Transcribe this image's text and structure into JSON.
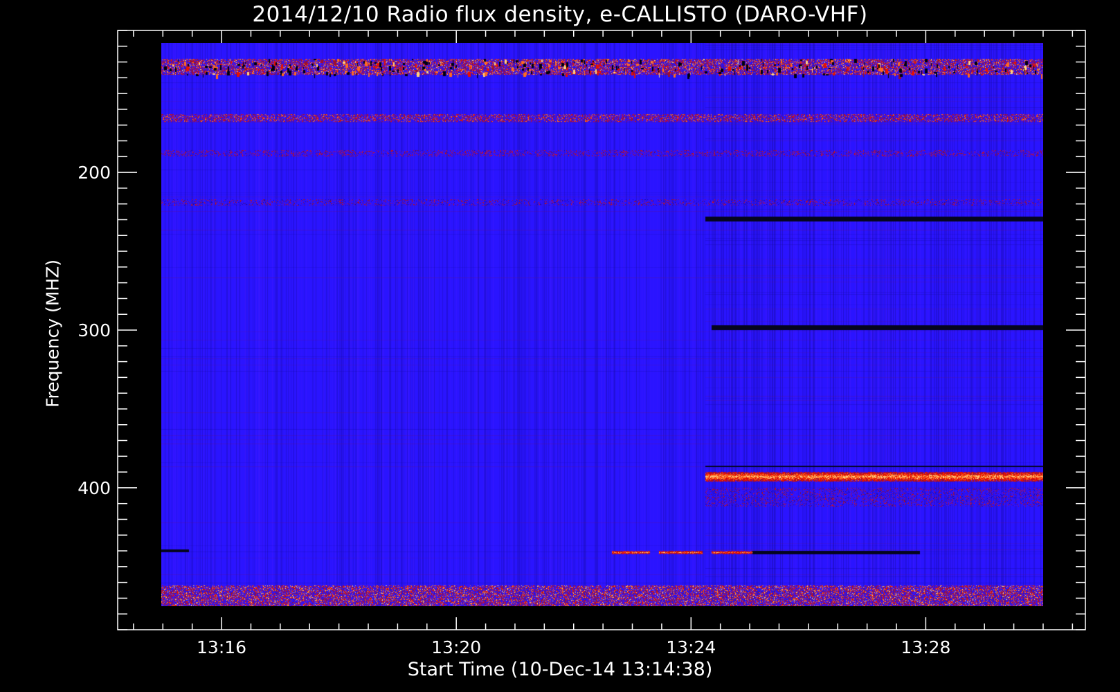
{
  "chart_data": {
    "type": "heatmap",
    "title": "2014/12/10  Radio flux density, e-CALLISTO (DARO-VHF)",
    "xlabel": "Start Time (10-Dec-14 13:14:38)",
    "ylabel": "Frequency (MHZ)",
    "x_tick_labels": [
      "13:16",
      "13:20",
      "13:24",
      "13:28"
    ],
    "x_tick_values_min": [
      796,
      800,
      804,
      808
    ],
    "x_range_min": [
      794.23,
      810.72
    ],
    "data_range_min": [
      794.97,
      810.0
    ],
    "y_tick_labels": [
      "200",
      "300",
      "400"
    ],
    "y_tick_values": [
      200,
      300,
      400
    ],
    "y_range": [
      110,
      490
    ],
    "data_range_mhz": [
      118,
      475
    ],
    "y_inverted": true,
    "colormap": [
      "#000000",
      "#1a0aa8",
      "#2e0aff",
      "#4a10e8",
      "#9a1030",
      "#e81000",
      "#ff6a20",
      "#ffd080"
    ],
    "background_level_color": "#2a14ff",
    "features": [
      {
        "label": "strong band",
        "freq_mhz": [
          390,
          396
        ],
        "time_min": [
          804.25,
          810.0
        ],
        "intensity": 0.95
      },
      {
        "label": "dark line above band",
        "freq_mhz": [
          386,
          387
        ],
        "time_min": [
          804.25,
          810.0
        ],
        "intensity": 0.0
      },
      {
        "label": "dark line",
        "freq_mhz": [
          297,
          300
        ],
        "time_min": [
          804.35,
          810.0
        ],
        "intensity": 0.02
      },
      {
        "label": "dark line",
        "freq_mhz": [
          228,
          231
        ],
        "time_min": [
          804.25,
          810.0
        ],
        "intensity": 0.05
      },
      {
        "label": "dashed bright segment",
        "freq_mhz": [
          440,
          442
        ],
        "time_min": [
          802.65,
          803.3
        ],
        "intensity": 0.9
      },
      {
        "label": "dashed bright segment",
        "freq_mhz": [
          440,
          442
        ],
        "time_min": [
          803.45,
          804.2
        ],
        "intensity": 0.9
      },
      {
        "label": "dashed bright segment",
        "freq_mhz": [
          440,
          442
        ],
        "time_min": [
          804.35,
          805.05
        ],
        "intensity": 0.9
      },
      {
        "label": "dark line",
        "freq_mhz": [
          440,
          442
        ],
        "time_min": [
          805.05,
          807.9
        ],
        "intensity": 0.0
      },
      {
        "label": "dark line",
        "freq_mhz": [
          439,
          441
        ],
        "time_min": [
          794.97,
          795.45
        ],
        "intensity": 0.0
      },
      {
        "label": "noisy rfi band",
        "freq_mhz": [
          128,
          138
        ],
        "time_min": [
          794.97,
          810.0
        ],
        "intensity": 0.55
      },
      {
        "label": "noisy rfi band",
        "freq_mhz": [
          163,
          168
        ],
        "time_min": [
          794.97,
          810.0
        ],
        "intensity": 0.5
      },
      {
        "label": "noisy rfi band",
        "freq_mhz": [
          462,
          475
        ],
        "time_min": [
          794.97,
          810.0
        ],
        "intensity": 0.55
      },
      {
        "label": "faint band",
        "freq_mhz": [
          186,
          190
        ],
        "time_min": [
          794.97,
          810.0
        ],
        "intensity": 0.35
      },
      {
        "label": "faint band",
        "freq_mhz": [
          217,
          221
        ],
        "time_min": [
          794.97,
          810.0
        ],
        "intensity": 0.3
      },
      {
        "label": "faint band",
        "freq_mhz": [
          400,
          412
        ],
        "time_min": [
          804.25,
          810.0
        ],
        "intensity": 0.3
      }
    ]
  }
}
